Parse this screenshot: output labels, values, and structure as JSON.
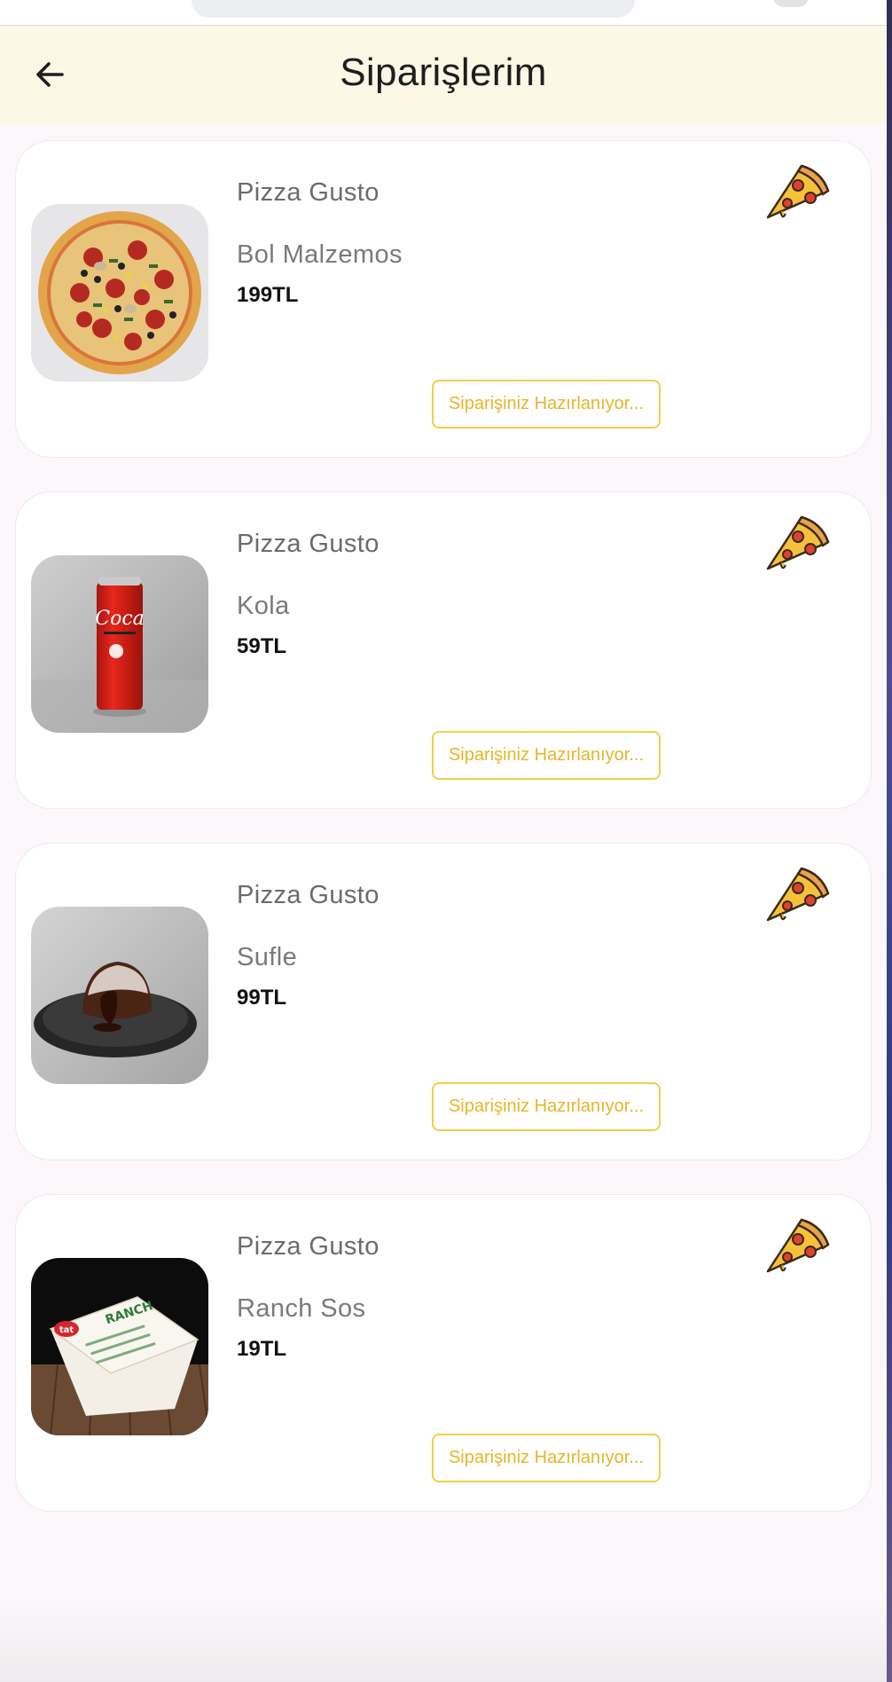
{
  "header": {
    "title": "Siparişlerim",
    "back_icon": "arrow-left-icon"
  },
  "orders": [
    {
      "restaurant": "Pizza Gusto",
      "product": "Bol Malzemos",
      "price": "199TL",
      "status": "Siparişiniz Hazırlanıyor...",
      "image": "pizza-photo",
      "icon": "pizza-slice-icon"
    },
    {
      "restaurant": "Pizza Gusto",
      "product": "Kola",
      "price": "59TL",
      "status": "Siparişiniz Hazırlanıyor...",
      "image": "cola-can-photo",
      "icon": "pizza-slice-icon"
    },
    {
      "restaurant": "Pizza Gusto",
      "product": "Sufle",
      "price": "99TL",
      "status": "Siparişiniz Hazırlanıyor...",
      "image": "souffle-photo",
      "icon": "pizza-slice-icon"
    },
    {
      "restaurant": "Pizza Gusto",
      "product": "Ranch Sos",
      "price": "19TL",
      "status": "Siparişiniz Hazırlanıyor...",
      "image": "ranch-sauce-photo",
      "icon": "pizza-slice-icon"
    }
  ],
  "colors": {
    "header_bg": "#fdf8e6",
    "page_bg": "#fcf7fa",
    "status_accent": "#e7b529",
    "status_border": "#f1cf4a"
  }
}
